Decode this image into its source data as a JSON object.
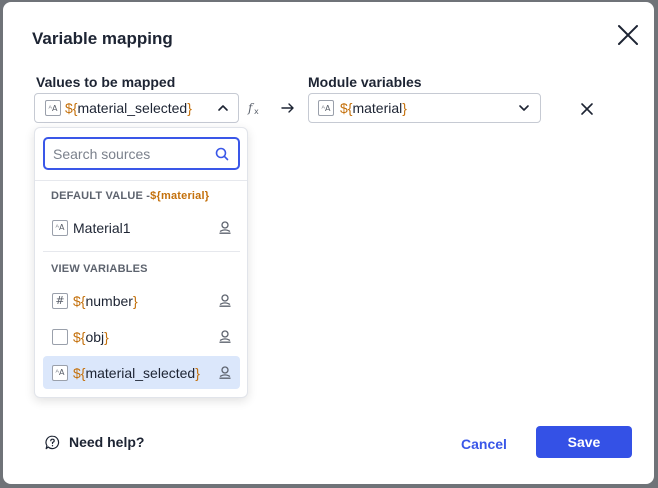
{
  "dialog": {
    "title": "Variable mapping",
    "values_label": "Values to be mapped",
    "module_label": "Module variables"
  },
  "source_select": {
    "value_prefix": "${",
    "value_name": "material_selected",
    "value_suffix": "}",
    "type_icon": "text-type-icon"
  },
  "module_select": {
    "value_prefix": "${",
    "value_name": "material",
    "value_suffix": "}",
    "type_icon": "text-type-icon"
  },
  "dropdown": {
    "search_placeholder": "Search sources",
    "default_section": {
      "label": "DEFAULT VALUE -",
      "var_prefix": "${",
      "var_name": "material",
      "var_suffix": "}"
    },
    "default_item": {
      "label": "Material1",
      "type_icon": "text-type-icon"
    },
    "view_section_label": "VIEW VARIABLES",
    "view_items": [
      {
        "prefix": "${",
        "name": "number",
        "suffix": "}",
        "type_icon": "number-type-icon",
        "selected": false
      },
      {
        "prefix": "${",
        "name": "obj",
        "suffix": "}",
        "type_icon": "object-type-icon",
        "selected": false
      },
      {
        "prefix": "${",
        "name": "material_selected",
        "suffix": "}",
        "type_icon": "text-type-icon",
        "selected": true
      }
    ]
  },
  "footer": {
    "help_label": "Need help?",
    "cancel_label": "Cancel",
    "save_label": "Save"
  },
  "colors": {
    "primary": "#3451e6",
    "variable_brace": "#c4700b",
    "selected_row": "#dbe7fb"
  }
}
